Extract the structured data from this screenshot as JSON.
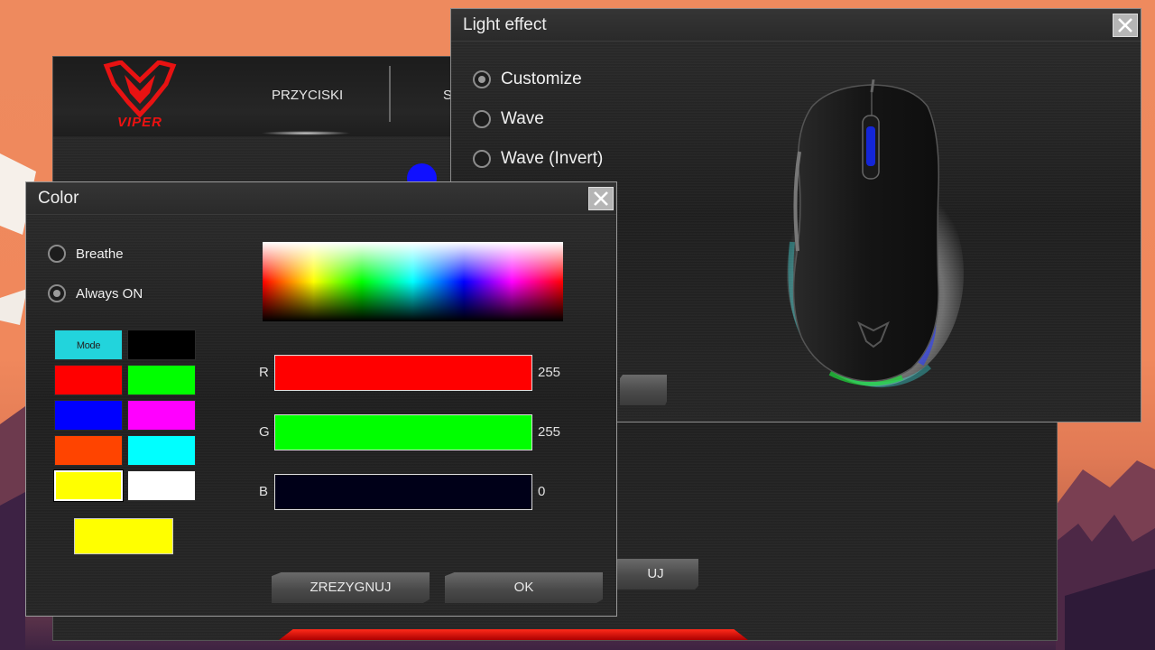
{
  "main_app": {
    "logo_text": "VIPER",
    "tabs": [
      {
        "label": "PRZYCISKI"
      },
      {
        "label": "S"
      }
    ],
    "partial_button_label": "UJ"
  },
  "light_effect": {
    "title": "Light effect",
    "options": [
      {
        "label": "Customize",
        "checked": true
      },
      {
        "label": "Wave",
        "checked": false
      },
      {
        "label": "Wave (Invert)",
        "checked": false
      }
    ],
    "led_colors": [
      "#ffffff",
      "#ffffff",
      "#66f0f5",
      "#ffffff",
      "#ffffff",
      "#1010ff",
      "#ffffff",
      "#1010ff",
      "#11dd22",
      "#ffffff"
    ]
  },
  "color_dialog": {
    "title": "Color",
    "modes": [
      {
        "label": "Breathe",
        "checked": false
      },
      {
        "label": "Always ON",
        "checked": true
      }
    ],
    "mode_swatch_label": "Mode",
    "swatches": [
      "#22d4dc",
      "#000000",
      "#ff0000",
      "#00ff00",
      "#0000ff",
      "#ff00ff",
      "#ff4400",
      "#00ffff",
      "#ffff00",
      "#ffffff"
    ],
    "selected_swatch": 8,
    "preview_color": "#ffff00",
    "channels": [
      {
        "label": "R",
        "value": "255",
        "color": "#ff0000"
      },
      {
        "label": "G",
        "value": "255",
        "color": "#00ff00"
      },
      {
        "label": "B",
        "value": "0",
        "color": "#000018"
      }
    ],
    "cancel_label": "ZREZYGNUJ",
    "ok_label": "OK"
  }
}
